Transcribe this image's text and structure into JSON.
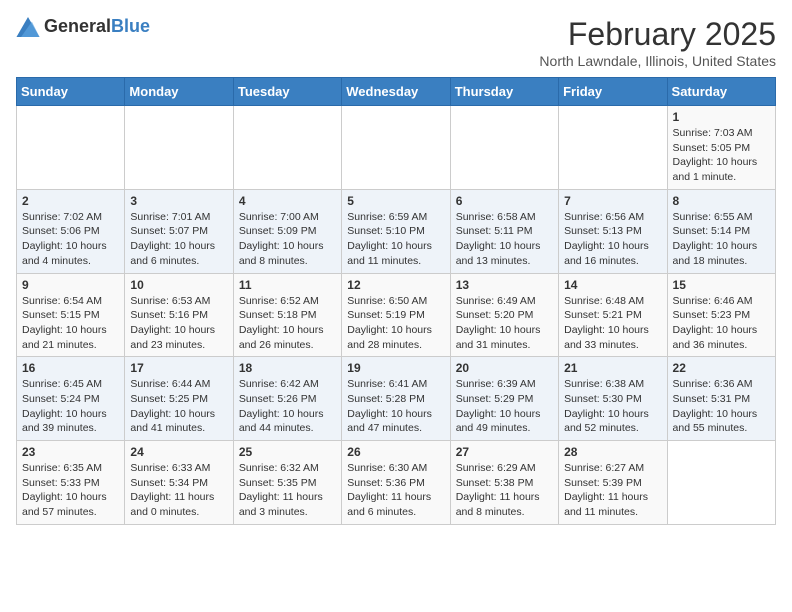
{
  "logo": {
    "general": "General",
    "blue": "Blue"
  },
  "title": "February 2025",
  "location": "North Lawndale, Illinois, United States",
  "days_of_week": [
    "Sunday",
    "Monday",
    "Tuesday",
    "Wednesday",
    "Thursday",
    "Friday",
    "Saturday"
  ],
  "weeks": [
    [
      {
        "day": "",
        "info": ""
      },
      {
        "day": "",
        "info": ""
      },
      {
        "day": "",
        "info": ""
      },
      {
        "day": "",
        "info": ""
      },
      {
        "day": "",
        "info": ""
      },
      {
        "day": "",
        "info": ""
      },
      {
        "day": "1",
        "info": "Sunrise: 7:03 AM\nSunset: 5:05 PM\nDaylight: 10 hours and 1 minute."
      }
    ],
    [
      {
        "day": "2",
        "info": "Sunrise: 7:02 AM\nSunset: 5:06 PM\nDaylight: 10 hours and 4 minutes."
      },
      {
        "day": "3",
        "info": "Sunrise: 7:01 AM\nSunset: 5:07 PM\nDaylight: 10 hours and 6 minutes."
      },
      {
        "day": "4",
        "info": "Sunrise: 7:00 AM\nSunset: 5:09 PM\nDaylight: 10 hours and 8 minutes."
      },
      {
        "day": "5",
        "info": "Sunrise: 6:59 AM\nSunset: 5:10 PM\nDaylight: 10 hours and 11 minutes."
      },
      {
        "day": "6",
        "info": "Sunrise: 6:58 AM\nSunset: 5:11 PM\nDaylight: 10 hours and 13 minutes."
      },
      {
        "day": "7",
        "info": "Sunrise: 6:56 AM\nSunset: 5:13 PM\nDaylight: 10 hours and 16 minutes."
      },
      {
        "day": "8",
        "info": "Sunrise: 6:55 AM\nSunset: 5:14 PM\nDaylight: 10 hours and 18 minutes."
      }
    ],
    [
      {
        "day": "9",
        "info": "Sunrise: 6:54 AM\nSunset: 5:15 PM\nDaylight: 10 hours and 21 minutes."
      },
      {
        "day": "10",
        "info": "Sunrise: 6:53 AM\nSunset: 5:16 PM\nDaylight: 10 hours and 23 minutes."
      },
      {
        "day": "11",
        "info": "Sunrise: 6:52 AM\nSunset: 5:18 PM\nDaylight: 10 hours and 26 minutes."
      },
      {
        "day": "12",
        "info": "Sunrise: 6:50 AM\nSunset: 5:19 PM\nDaylight: 10 hours and 28 minutes."
      },
      {
        "day": "13",
        "info": "Sunrise: 6:49 AM\nSunset: 5:20 PM\nDaylight: 10 hours and 31 minutes."
      },
      {
        "day": "14",
        "info": "Sunrise: 6:48 AM\nSunset: 5:21 PM\nDaylight: 10 hours and 33 minutes."
      },
      {
        "day": "15",
        "info": "Sunrise: 6:46 AM\nSunset: 5:23 PM\nDaylight: 10 hours and 36 minutes."
      }
    ],
    [
      {
        "day": "16",
        "info": "Sunrise: 6:45 AM\nSunset: 5:24 PM\nDaylight: 10 hours and 39 minutes."
      },
      {
        "day": "17",
        "info": "Sunrise: 6:44 AM\nSunset: 5:25 PM\nDaylight: 10 hours and 41 minutes."
      },
      {
        "day": "18",
        "info": "Sunrise: 6:42 AM\nSunset: 5:26 PM\nDaylight: 10 hours and 44 minutes."
      },
      {
        "day": "19",
        "info": "Sunrise: 6:41 AM\nSunset: 5:28 PM\nDaylight: 10 hours and 47 minutes."
      },
      {
        "day": "20",
        "info": "Sunrise: 6:39 AM\nSunset: 5:29 PM\nDaylight: 10 hours and 49 minutes."
      },
      {
        "day": "21",
        "info": "Sunrise: 6:38 AM\nSunset: 5:30 PM\nDaylight: 10 hours and 52 minutes."
      },
      {
        "day": "22",
        "info": "Sunrise: 6:36 AM\nSunset: 5:31 PM\nDaylight: 10 hours and 55 minutes."
      }
    ],
    [
      {
        "day": "23",
        "info": "Sunrise: 6:35 AM\nSunset: 5:33 PM\nDaylight: 10 hours and 57 minutes."
      },
      {
        "day": "24",
        "info": "Sunrise: 6:33 AM\nSunset: 5:34 PM\nDaylight: 11 hours and 0 minutes."
      },
      {
        "day": "25",
        "info": "Sunrise: 6:32 AM\nSunset: 5:35 PM\nDaylight: 11 hours and 3 minutes."
      },
      {
        "day": "26",
        "info": "Sunrise: 6:30 AM\nSunset: 5:36 PM\nDaylight: 11 hours and 6 minutes."
      },
      {
        "day": "27",
        "info": "Sunrise: 6:29 AM\nSunset: 5:38 PM\nDaylight: 11 hours and 8 minutes."
      },
      {
        "day": "28",
        "info": "Sunrise: 6:27 AM\nSunset: 5:39 PM\nDaylight: 11 hours and 11 minutes."
      },
      {
        "day": "",
        "info": ""
      }
    ]
  ]
}
